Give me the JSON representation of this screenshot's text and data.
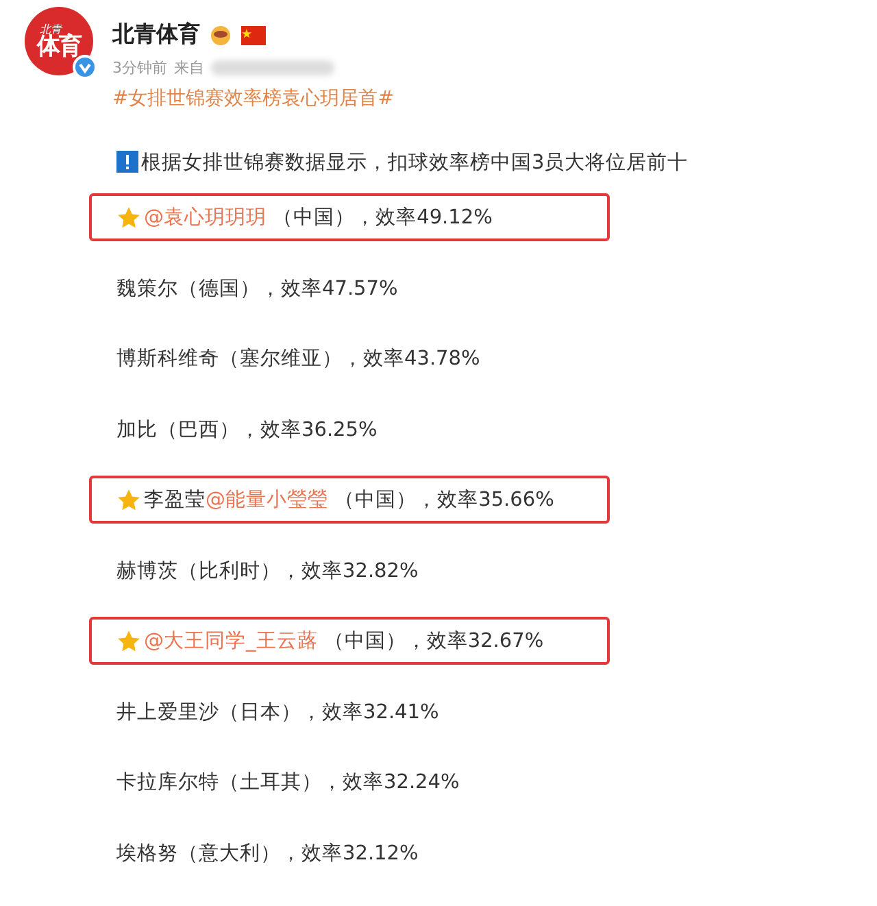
{
  "author": {
    "avatar_small": "北青",
    "avatar_big": "体育",
    "verified": true,
    "name": "北青体育"
  },
  "meta": {
    "time": "3分钟前",
    "source_label": "来自"
  },
  "hashtag": "#女排世锦赛效率榜袁心玥居首#",
  "intro": "根据女排世锦赛数据显示，扣球效率榜中国3员大将位居前十",
  "rows": [
    {
      "highlighted": true,
      "star": true,
      "segments": [
        {
          "kind": "mention",
          "text": "@袁心玥玥玥"
        },
        {
          "kind": "plain",
          "text": " （中国），效率49.12%"
        }
      ]
    },
    {
      "highlighted": false,
      "star": false,
      "segments": [
        {
          "kind": "plain",
          "text": "魏策尔（德国），效率47.57%"
        }
      ]
    },
    {
      "highlighted": false,
      "star": false,
      "segments": [
        {
          "kind": "plain",
          "text": "博斯科维奇（塞尔维亚），效率43.78%"
        }
      ]
    },
    {
      "highlighted": false,
      "star": false,
      "segments": [
        {
          "kind": "plain",
          "text": "加比（巴西），效率36.25%"
        }
      ]
    },
    {
      "highlighted": true,
      "star": true,
      "segments": [
        {
          "kind": "plain",
          "text": "李盈莹"
        },
        {
          "kind": "mention",
          "text": "@能量小瑩瑩"
        },
        {
          "kind": "plain",
          "text": " （中国），效率35.66%"
        }
      ]
    },
    {
      "highlighted": false,
      "star": false,
      "segments": [
        {
          "kind": "plain",
          "text": "赫博茨（比利时），效率32.82%"
        }
      ]
    },
    {
      "highlighted": true,
      "star": true,
      "segments": [
        {
          "kind": "mention",
          "text": "@大王同学_王云蕗"
        },
        {
          "kind": "plain",
          "text": " （中国），效率32.67%"
        }
      ]
    },
    {
      "highlighted": false,
      "star": false,
      "segments": [
        {
          "kind": "plain",
          "text": "井上爱里沙（日本），效率32.41%"
        }
      ]
    },
    {
      "highlighted": false,
      "star": false,
      "segments": [
        {
          "kind": "plain",
          "text": "卡拉库尔特（土耳其），效率32.24%"
        }
      ]
    },
    {
      "highlighted": false,
      "star": false,
      "segments": [
        {
          "kind": "plain",
          "text": "埃格努（意大利），效率32.12%"
        }
      ]
    }
  ]
}
